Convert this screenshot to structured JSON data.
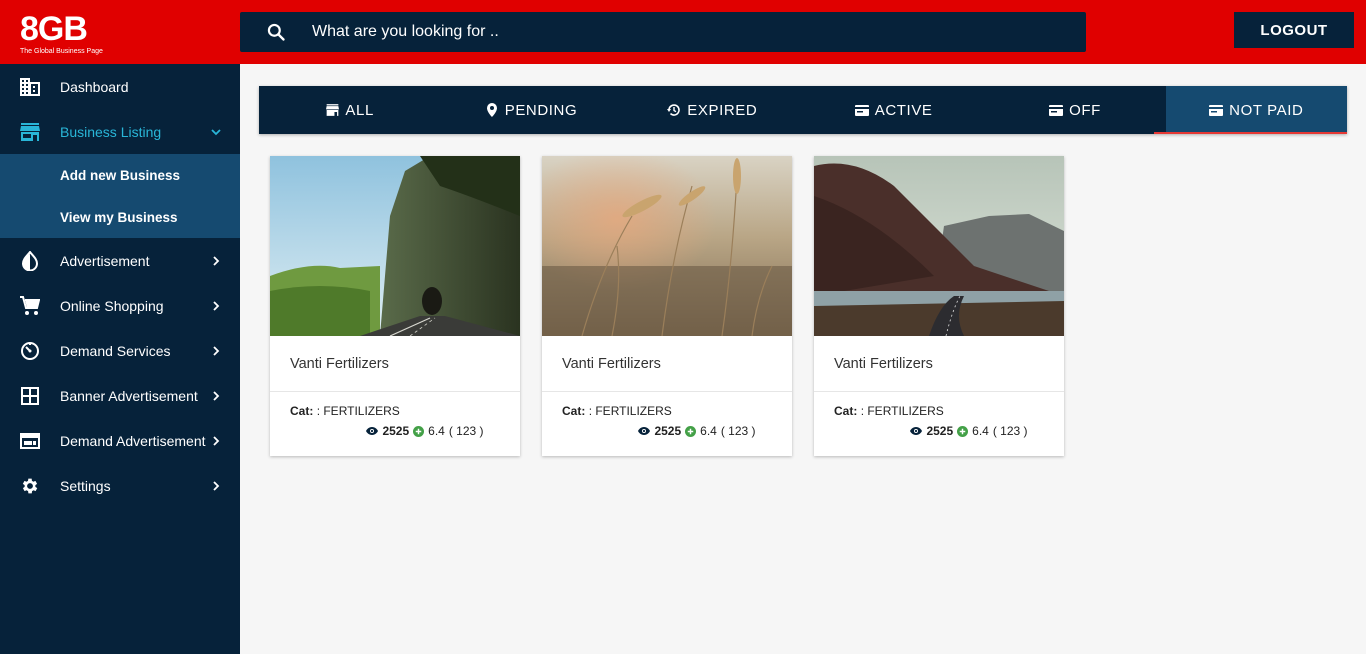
{
  "logo": {
    "text": "8GB",
    "tagline": "The Global Business Page"
  },
  "search": {
    "placeholder": "What are you looking for .."
  },
  "header": {
    "logout_label": "LOGOUT"
  },
  "sidebar": {
    "items": [
      {
        "label": "Dashboard",
        "icon": "building-icon"
      },
      {
        "label": "Business Listing",
        "icon": "store-icon",
        "active": true,
        "children": [
          {
            "label": "Add new Business"
          },
          {
            "label": "View my Business"
          }
        ]
      },
      {
        "label": "Advertisement",
        "icon": "contrast-icon"
      },
      {
        "label": "Online Shopping",
        "icon": "cart-icon"
      },
      {
        "label": "Demand Services",
        "icon": "timer-icon"
      },
      {
        "label": "Banner Advertisement",
        "icon": "grid-icon"
      },
      {
        "label": "Demand Advertisement",
        "icon": "web-icon"
      },
      {
        "label": "Settings",
        "icon": "gear-icon"
      }
    ]
  },
  "tabs": [
    {
      "label": "ALL",
      "icon": "store-icon"
    },
    {
      "label": "PENDING",
      "icon": "pin-icon"
    },
    {
      "label": "EXPIRED",
      "icon": "history-icon"
    },
    {
      "label": "ACTIVE",
      "icon": "card-icon"
    },
    {
      "label": "OFF",
      "icon": "card-icon"
    },
    {
      "label": "NOT PAID",
      "icon": "card-icon",
      "selected": true
    }
  ],
  "cards": [
    {
      "title": "Vanti Fertilizers",
      "cat_label": "Cat:",
      "cat_value": ": FERTILIZERS",
      "views": "2525",
      "rating": "6.4",
      "reviews": "( 123 )",
      "image": "road-tunnel-cliff"
    },
    {
      "title": "Vanti Fertilizers",
      "cat_label": "Cat:",
      "cat_value": ": FERTILIZERS",
      "views": "2525",
      "rating": "6.4",
      "reviews": "( 123 )",
      "image": "wheat-field"
    },
    {
      "title": "Vanti Fertilizers",
      "cat_label": "Cat:",
      "cat_value": ": FERTILIZERS",
      "views": "2525",
      "rating": "6.4",
      "reviews": "( 123 )",
      "image": "mountain-road"
    }
  ],
  "colors": {
    "header_red": "#e00000",
    "navy": "#06223a",
    "selected_blue": "#154a70",
    "accent_cyan": "#29b6d8",
    "rating_green": "#43a047"
  }
}
